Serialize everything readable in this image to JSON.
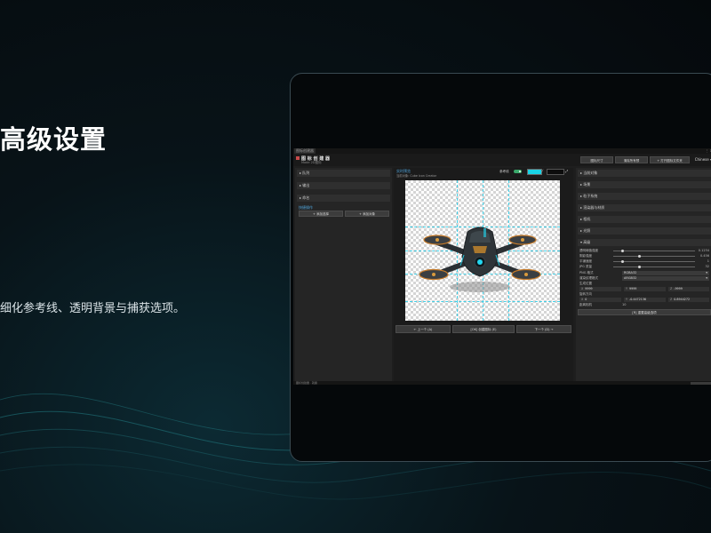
{
  "slide": {
    "title": "高级设置",
    "description": "细化参考线、透明背景与捕获选项。"
  },
  "window": {
    "tab_title": "图标创建器",
    "app_title": "图 标 创 建 器",
    "app_subtitle": "Made 2D图标",
    "window_controls": "⋮ ✕"
  },
  "header_buttons": {
    "icon_size": "图标尺寸",
    "clear_preview": "清除所有预",
    "open_folder": "+ 打开图标文件夹",
    "language": "Chinese"
  },
  "left_panel": {
    "sections": [
      "队列",
      "输出",
      "命名"
    ],
    "group_label": "快捷操作",
    "add_selection": "+ 添加选择",
    "add_object": "+ 添加对象"
  },
  "preview": {
    "title": "实时预览",
    "subtitle": "当前对象: Cube Icon Creator",
    "reference_label": "参考线",
    "prev_button": "← 上一个 (A)",
    "create_button": "[OK] 创建图标 (E)",
    "next_button": "下一个 (D) →",
    "guide_color": "#19d3e6",
    "background_color": "#0c0c0c"
  },
  "right_panel": {
    "sections": [
      "当前对象",
      "场景",
      "粒子系统",
      "渲染器与材质",
      "相机",
      "光照"
    ],
    "advanced_section": "▾ 高级",
    "properties": [
      {
        "label": "透明阈值强度",
        "value": "0.1234",
        "fraction": 0.1
      },
      {
        "label": "阴影强度",
        "value": "0.456",
        "fraction": 0.3
      },
      {
        "label": "平铺速度",
        "value": "1",
        "fraction": 0.1
      },
      {
        "label": "JPG 质量",
        "value": "32",
        "fraction": 0.3
      }
    ],
    "png_format_label": "PNG 格式",
    "png_format_value": "RGBA32",
    "render_format_label": "渲染纹理格式",
    "render_format_value": "ARGB32",
    "position_label": "生成位置",
    "position": {
      "x": "9999",
      "y": "9999",
      "z": "-9999"
    },
    "rotation_label": "旋转方向",
    "rotation": {
      "x": "0",
      "y": "-0.4472136",
      "z": "0.8944272"
    },
    "distance_label": "距离相机",
    "distance_value": "10",
    "reset_button": "[R] 重置高级选项"
  },
  "status": {
    "left": "图标创建器 · 就绪"
  }
}
